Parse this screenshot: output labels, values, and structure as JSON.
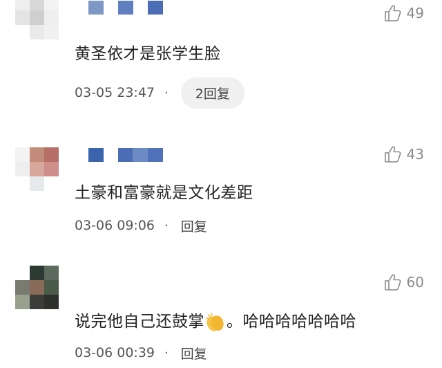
{
  "comments": [
    {
      "username_block_colors": [
        "#7e98c6",
        "#5f7fbf",
        "#4a6db5"
      ],
      "avatar_colors": [
        "#eeeeee",
        "#d8d8d8",
        "#f3f3f3",
        "#e4e4e4",
        "#cfcfcf",
        "#efefef",
        "#f5f5f5",
        "#e9e9e9",
        "#f1f1f1"
      ],
      "likes": "49",
      "text": "黄圣依才是张学生脸",
      "time": "03-05 23:47",
      "dot": "·",
      "reply": "2回复"
    },
    {
      "username_block_colors": [
        "#3c64ad",
        "#4a6db5",
        "#6c8bc4",
        "#4f72b8"
      ],
      "avatar_colors": [
        "#f3f3f3",
        "#c38c7a",
        "#b56f66",
        "#eeeeee",
        "#d6a79a",
        "#cf8e8a",
        "#f7f7f7",
        "#e6e9ec",
        "#ffffff"
      ],
      "likes": "43",
      "text": "土豪和富豪就是文化差距",
      "time": "03-06 09:06",
      "dot": "·",
      "reply": "回复"
    },
    {
      "username_block_colors": [],
      "avatar_colors": [
        "#ffffff",
        "#2c3a33",
        "#5b6a5c",
        "#7a7b70",
        "#8a6a58",
        "#4a5a48",
        "#9aa08e",
        "#3a3d3a",
        "#2e302c"
      ],
      "likes": "60",
      "text": "说完他自己还鼓掌",
      "text_after": "。哈哈哈哈哈哈哈",
      "emoji_name": "clapping-hands-emoji",
      "time": "03-06 00:39",
      "dot": "·",
      "reply": "回复"
    }
  ],
  "icons": {
    "like": "thumbs-up-icon"
  },
  "colors": {
    "meta_text": "#555555",
    "likes_text": "#8a8a8a",
    "reply_pill_bg": "#f0f0f0"
  }
}
